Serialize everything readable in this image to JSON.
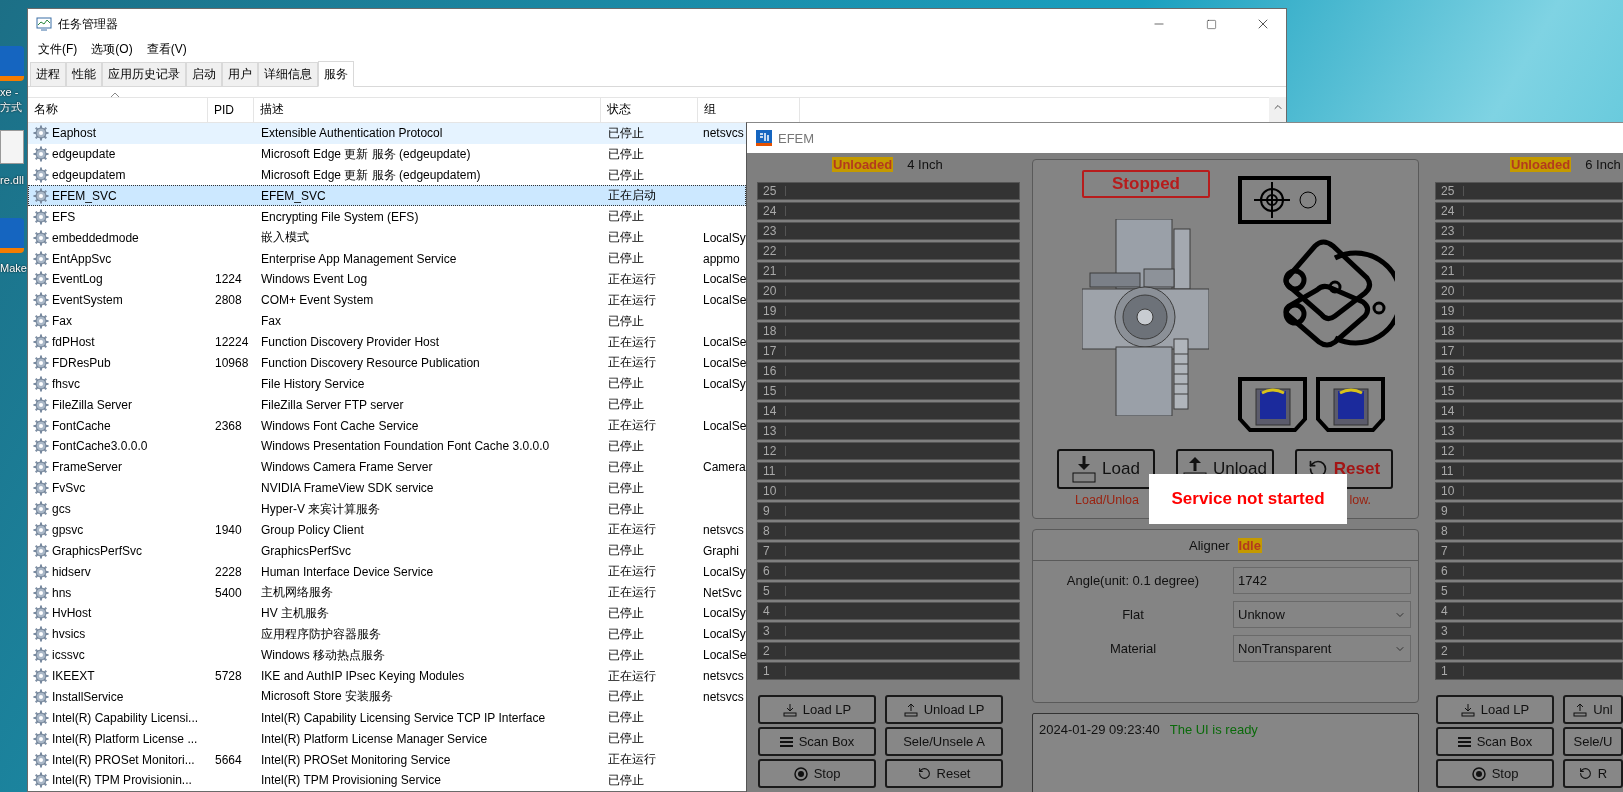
{
  "desktop": {
    "icon_labels": [
      "xe -",
      "方式",
      "re.dll",
      "Make"
    ]
  },
  "task_manager": {
    "title": "任务管理器",
    "menu": [
      "文件(F)",
      "选项(O)",
      "查看(V)"
    ],
    "tabs": [
      {
        "label": "进程",
        "selected": false
      },
      {
        "label": "性能",
        "selected": false
      },
      {
        "label": "应用历史记录",
        "selected": false
      },
      {
        "label": "启动",
        "selected": false
      },
      {
        "label": "用户",
        "selected": false
      },
      {
        "label": "详细信息",
        "selected": false
      },
      {
        "label": "服务",
        "selected": true
      }
    ],
    "columns": [
      "名称",
      "PID",
      "描述",
      "状态",
      "组"
    ],
    "rows": [
      {
        "name": "Eaphost",
        "description": "Extensible Authentication Protocol",
        "status": "已停止",
        "group": "netsvcs",
        "selected": false,
        "hovered": true
      },
      {
        "name": "edgeupdate",
        "description": "Microsoft Edge 更新 服务 (edgeupdate)",
        "status": "已停止",
        "selected": false,
        "hovered": false
      },
      {
        "name": "edgeupdatem",
        "description": "Microsoft Edge 更新 服务 (edgeupdatem)",
        "status": "已停止",
        "selected": false,
        "hovered": false
      },
      {
        "name": "EFEM_SVC",
        "description": "EFEM_SVC",
        "status": "正在启动",
        "selected": true,
        "hovered": false
      },
      {
        "name": "EFS",
        "description": "Encrypting File System (EFS)",
        "status": "已停止",
        "selected": false,
        "hovered": false
      },
      {
        "name": "embeddedmode",
        "description": "嵌入模式",
        "status": "已停止",
        "group": "LocalSy",
        "selected": false,
        "hovered": false
      },
      {
        "name": "EntAppSvc",
        "description": "Enterprise App Management Service",
        "status": "已停止",
        "group": "appmo",
        "selected": false,
        "hovered": false
      },
      {
        "name": "EventLog",
        "pid": "1224",
        "description": "Windows Event Log",
        "status": "正在运行",
        "group": "LocalSe",
        "selected": false,
        "hovered": false
      },
      {
        "name": "EventSystem",
        "pid": "2808",
        "description": "COM+ Event System",
        "status": "正在运行",
        "group": "LocalSe",
        "selected": false,
        "hovered": false
      },
      {
        "name": "Fax",
        "description": "Fax",
        "status": "已停止",
        "selected": false,
        "hovered": false
      },
      {
        "name": "fdPHost",
        "pid": "12224",
        "description": "Function Discovery Provider Host",
        "status": "正在运行",
        "group": "LocalSe",
        "selected": false,
        "hovered": false
      },
      {
        "name": "FDResPub",
        "pid": "10968",
        "description": "Function Discovery Resource Publication",
        "status": "正在运行",
        "group": "LocalSe",
        "selected": false,
        "hovered": false
      },
      {
        "name": "fhsvc",
        "description": "File History Service",
        "status": "已停止",
        "group": "LocalSy",
        "selected": false,
        "hovered": false
      },
      {
        "name": "FileZilla Server",
        "description": "FileZilla Server FTP server",
        "status": "已停止",
        "selected": false,
        "hovered": false
      },
      {
        "name": "FontCache",
        "pid": "2368",
        "description": "Windows Font Cache Service",
        "status": "正在运行",
        "group": "LocalSe",
        "selected": false,
        "hovered": false
      },
      {
        "name": "FontCache3.0.0.0",
        "description": "Windows Presentation Foundation Font Cache 3.0.0.0",
        "status": "已停止",
        "selected": false,
        "hovered": false
      },
      {
        "name": "FrameServer",
        "description": "Windows Camera Frame Server",
        "status": "已停止",
        "group": "Camera",
        "selected": false,
        "hovered": false
      },
      {
        "name": "FvSvc",
        "description": "NVIDIA FrameView SDK service",
        "status": "已停止",
        "selected": false,
        "hovered": false
      },
      {
        "name": "gcs",
        "description": "Hyper-V 来宾计算服务",
        "status": "已停止",
        "selected": false,
        "hovered": false
      },
      {
        "name": "gpsvc",
        "pid": "1940",
        "description": "Group Policy Client",
        "status": "正在运行",
        "group": "netsvcs",
        "selected": false,
        "hovered": false
      },
      {
        "name": "GraphicsPerfSvc",
        "description": "GraphicsPerfSvc",
        "status": "已停止",
        "group": "Graphi",
        "selected": false,
        "hovered": false
      },
      {
        "name": "hidserv",
        "pid": "2228",
        "description": "Human Interface Device Service",
        "status": "正在运行",
        "group": "LocalSy",
        "selected": false,
        "hovered": false
      },
      {
        "name": "hns",
        "pid": "5400",
        "description": "主机网络服务",
        "status": "正在运行",
        "group": "NetSvc",
        "selected": false,
        "hovered": false
      },
      {
        "name": "HvHost",
        "description": "HV 主机服务",
        "status": "已停止",
        "group": "LocalSy",
        "selected": false,
        "hovered": false
      },
      {
        "name": "hvsics",
        "description": "应用程序防护容器服务",
        "status": "已停止",
        "group": "LocalSy",
        "selected": false,
        "hovered": false
      },
      {
        "name": "icssvc",
        "description": "Windows 移动热点服务",
        "status": "已停止",
        "group": "LocalSe",
        "selected": false,
        "hovered": false
      },
      {
        "name": "IKEEXT",
        "pid": "5728",
        "description": "IKE and AuthIP IPsec Keying Modules",
        "status": "正在运行",
        "group": "netsvcs",
        "selected": false,
        "hovered": false
      },
      {
        "name": "InstallService",
        "description": "Microsoft Store 安装服务",
        "status": "已停止",
        "group": "netsvcs",
        "selected": false,
        "hovered": false
      },
      {
        "name": "Intel(R) Capability Licensi...",
        "description": "Intel(R) Capability Licensing Service TCP IP Interface",
        "status": "已停止",
        "selected": false,
        "hovered": false
      },
      {
        "name": "Intel(R) Platform License ...",
        "description": "Intel(R) Platform License Manager Service",
        "status": "已停止",
        "selected": false,
        "hovered": false
      },
      {
        "name": "Intel(R) PROSet Monitori...",
        "pid": "5664",
        "description": "Intel(R) PROSet Monitoring Service",
        "status": "正在运行",
        "selected": false,
        "hovered": false
      },
      {
        "name": "Intel(R) TPM Provisionin...",
        "description": "Intel(R) TPM Provisioning Service",
        "status": "已停止",
        "selected": false,
        "hovered": false
      }
    ]
  },
  "efem": {
    "title": "EFEM",
    "ports": [
      {
        "status": "Unloaded",
        "size": "4 Inch",
        "slots": [
          "25",
          "24",
          "23",
          "22",
          "21",
          "20",
          "19",
          "18",
          "17",
          "16",
          "15",
          "14",
          "13",
          "12",
          "11",
          "10",
          "9",
          "8",
          "7",
          "6",
          "5",
          "4",
          "3",
          "2",
          "1"
        ],
        "buttons": [
          {
            "label": "Load LP",
            "kind": "load"
          },
          {
            "label": "Unload LP",
            "kind": "unload"
          },
          {
            "label": "Scan Box",
            "kind": "scan"
          },
          {
            "label": "Sele/Unsele A",
            "kind": "select"
          },
          {
            "label": "Stop",
            "kind": "stop"
          },
          {
            "label": "Reset",
            "kind": "reset"
          }
        ]
      },
      {
        "status": "Unloaded",
        "size": "6 Inch",
        "slots": [
          "25",
          "24",
          "23",
          "22",
          "21",
          "20",
          "19",
          "18",
          "17",
          "16",
          "15",
          "14",
          "13",
          "12",
          "11",
          "10",
          "9",
          "8",
          "7",
          "6",
          "5",
          "4",
          "3",
          "2",
          "1"
        ],
        "buttons": [
          {
            "label": "Load LP",
            "kind": "load"
          },
          {
            "label": "Unl",
            "kind": "unload"
          },
          {
            "label": "Scan Box",
            "kind": "scan"
          },
          {
            "label": "Sele/U",
            "kind": "select"
          },
          {
            "label": "Stop",
            "kind": "stop"
          },
          {
            "label": "R",
            "kind": "reset"
          }
        ]
      }
    ],
    "state": "Stopped",
    "actions": [
      {
        "label": "Load",
        "kind": "load"
      },
      {
        "label": "Unload",
        "kind": "unload"
      },
      {
        "label": "Reset",
        "kind": "reset"
      }
    ],
    "note_start": "Load/Unloa",
    "note_end": "low.",
    "toast": "Service not started",
    "aligner": {
      "title": "Aligner",
      "status": "Idle",
      "fields": [
        {
          "label": "Angle(unit:  0.1 degree)",
          "kind": "input",
          "value": "1742"
        },
        {
          "label": "Flat",
          "kind": "select",
          "value": "Unknow"
        },
        {
          "label": "Material",
          "kind": "select",
          "value": "NonTransparent"
        }
      ]
    },
    "log": [
      {
        "time": "2024-01-29 09:23:40",
        "message": "The UI is ready"
      }
    ]
  }
}
